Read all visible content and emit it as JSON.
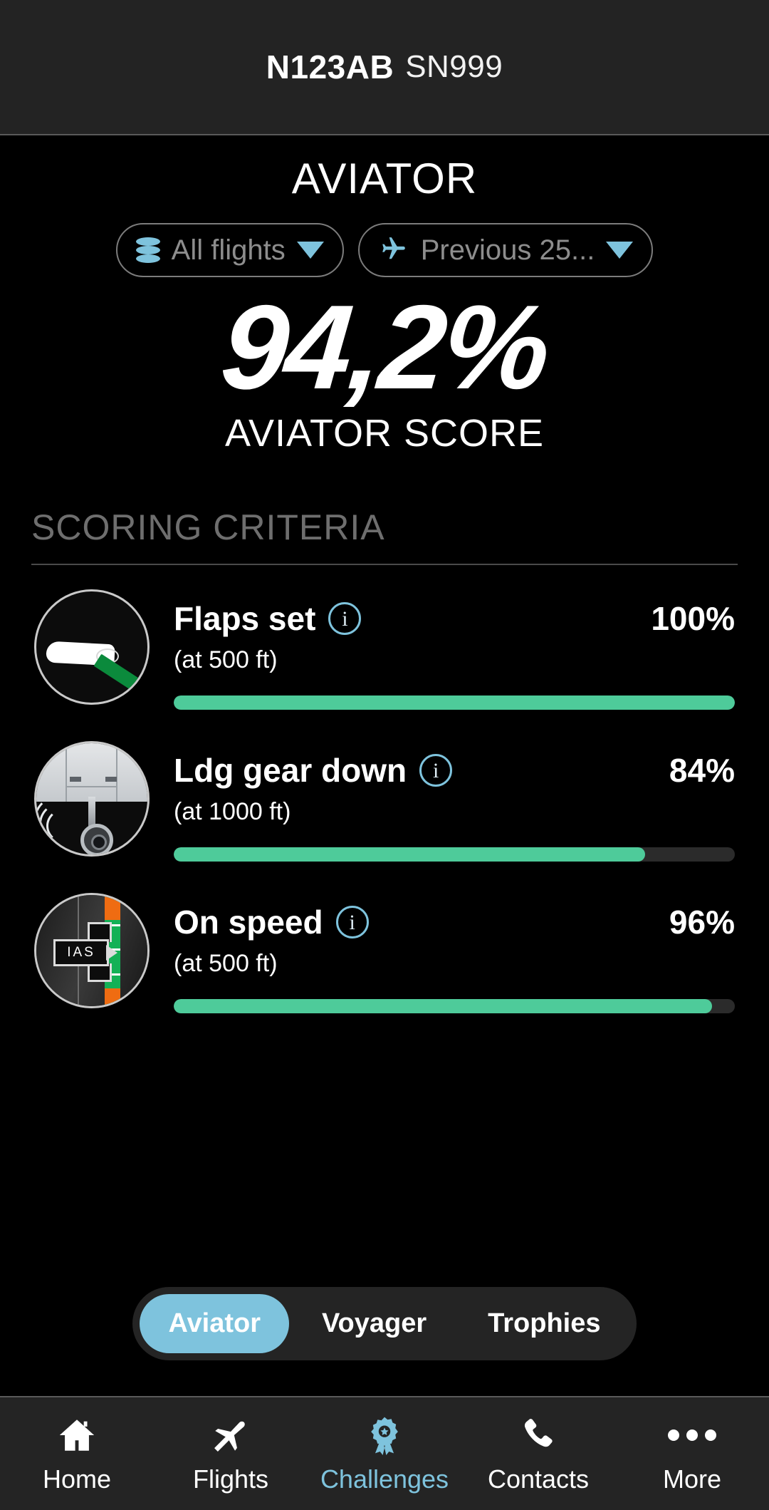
{
  "titlebar": {
    "tail_number": "N123AB",
    "serial_number": "SN999"
  },
  "page": {
    "title": "AVIATOR"
  },
  "filters": [
    {
      "icon": "database-icon",
      "label": "All flights",
      "caret": "chevron-down-icon"
    },
    {
      "icon": "airplane-icon",
      "label": "Previous 25...",
      "caret": "chevron-down-icon"
    }
  ],
  "score": {
    "value": "94,2%",
    "caption": "AVIATOR SCORE"
  },
  "section": {
    "title": "SCORING CRITERIA"
  },
  "criteria": [
    {
      "icon": "flaps-icon",
      "name": "Flaps set",
      "info": "i",
      "condition": "(at 500 ft)",
      "percent_label": "100%",
      "percent_value": 100
    },
    {
      "icon": "landing-gear-icon",
      "name": "Ldg gear down",
      "info": "i",
      "condition": "(at 1000 ft)",
      "percent_label": "84%",
      "percent_value": 84
    },
    {
      "icon": "airspeed-indicator-icon",
      "name": "On speed",
      "info": "i",
      "condition": "(at 500 ft)",
      "percent_label": "96%",
      "percent_value": 96,
      "ias_label": "IAS"
    }
  ],
  "segmented": {
    "items": [
      {
        "label": "Aviator",
        "active": true
      },
      {
        "label": "Voyager",
        "active": false
      },
      {
        "label": "Trophies",
        "active": false
      }
    ]
  },
  "tabbar": {
    "items": [
      {
        "icon": "home-icon",
        "label": "Home",
        "active": false
      },
      {
        "icon": "airplane-icon",
        "label": "Flights",
        "active": false
      },
      {
        "icon": "award-ribbon-icon",
        "label": "Challenges",
        "active": true
      },
      {
        "icon": "phone-icon",
        "label": "Contacts",
        "active": false
      },
      {
        "icon": "ellipsis-icon",
        "label": "More",
        "active": false
      }
    ]
  },
  "colors": {
    "accent_blue": "#7ec3dd",
    "progress_green": "#4ecb9a",
    "track_gray": "#2b2b2b",
    "muted_gray": "#8d8d8d",
    "bar_bg": "#242424"
  }
}
